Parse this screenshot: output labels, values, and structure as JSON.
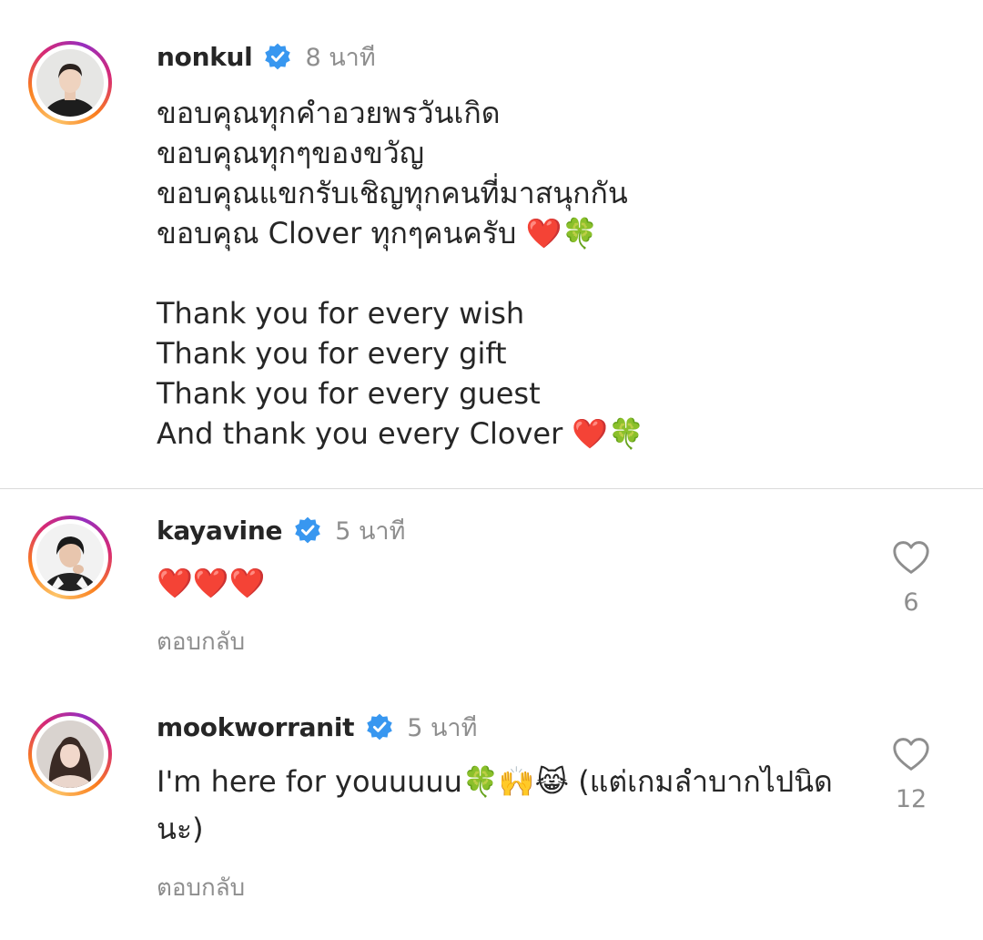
{
  "post": {
    "username": "nonkul",
    "time": "8 นาที",
    "caption_lines": [
      "ขอบคุณทุกคำอวยพรวันเกิด",
      "ขอบคุณทุกๆของขวัญ",
      "ขอบคุณแขกรับเชิญทุกคนที่มาสนุกกัน",
      "ขอบคุณ Clover ทุกๆคนครับ ❤️🍀",
      "",
      "Thank you for every wish",
      "Thank you for every gift",
      "Thank you for every guest",
      "And thank you every Clover ❤️🍀"
    ]
  },
  "comments": [
    {
      "username": "kayavine",
      "time": "5 นาที",
      "text": "❤️❤️❤️",
      "reply_label": "ตอบกลับ",
      "likes": "6"
    },
    {
      "username": "mookworranit",
      "time": "5 นาที",
      "text": "I'm here for youuuuu🍀🙌😹 (แต่เกมลำบากไปนิดนะ)",
      "reply_label": "ตอบกลับ",
      "likes": "12"
    }
  ],
  "icons": {
    "verified": "verified-badge-icon",
    "like": "heart-outline-icon"
  },
  "colors": {
    "verified_blue": "#3897f0",
    "secondary_text": "#8e8e8e",
    "primary_text": "#262626"
  }
}
